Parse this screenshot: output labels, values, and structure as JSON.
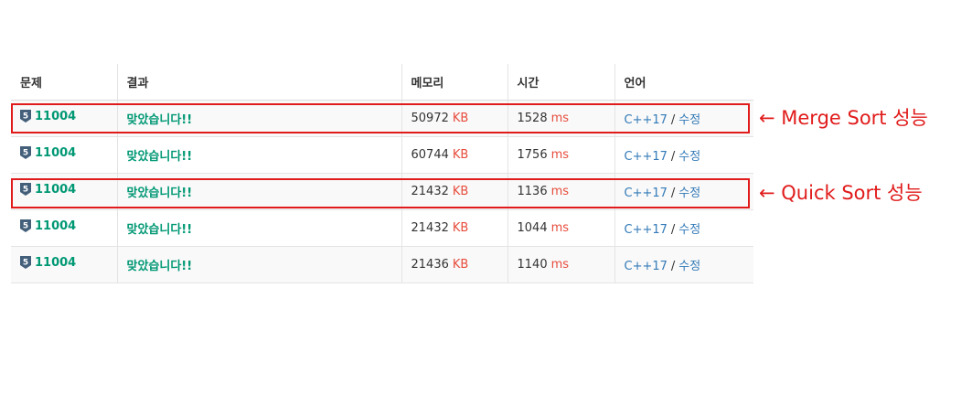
{
  "table": {
    "headers": {
      "problem": "문제",
      "result": "결과",
      "memory": "메모리",
      "time": "시간",
      "language": "언어"
    },
    "tier_icon": "tier-5-badge-icon",
    "rows": [
      {
        "tier": "5",
        "problem_id": "11004",
        "result": "맞았습니다!!",
        "memory": "50972",
        "memory_unit": "KB",
        "time": "1528",
        "time_unit": "ms",
        "language": "C++17",
        "separator": "/",
        "edit": "수정"
      },
      {
        "tier": "5",
        "problem_id": "11004",
        "result": "맞았습니다!!",
        "memory": "60744",
        "memory_unit": "KB",
        "time": "1756",
        "time_unit": "ms",
        "language": "C++17",
        "separator": "/",
        "edit": "수정"
      },
      {
        "tier": "5",
        "problem_id": "11004",
        "result": "맞았습니다!!",
        "memory": "21432",
        "memory_unit": "KB",
        "time": "1136",
        "time_unit": "ms",
        "language": "C++17",
        "separator": "/",
        "edit": "수정"
      },
      {
        "tier": "5",
        "problem_id": "11004",
        "result": "맞았습니다!!",
        "memory": "21432",
        "memory_unit": "KB",
        "time": "1044",
        "time_unit": "ms",
        "language": "C++17",
        "separator": "/",
        "edit": "수정"
      },
      {
        "tier": "5",
        "problem_id": "11004",
        "result": "맞았습니다!!",
        "memory": "21436",
        "memory_unit": "KB",
        "time": "1140",
        "time_unit": "ms",
        "language": "C++17",
        "separator": "/",
        "edit": "수정"
      }
    ]
  },
  "annotations": {
    "merge_sort": "← Merge Sort 성능",
    "quick_sort": "← Quick Sort 성능",
    "color": "#e11b1b"
  },
  "colors": {
    "accepted": "#009874",
    "unit": "#e74c3c",
    "link": "#337ab7"
  }
}
